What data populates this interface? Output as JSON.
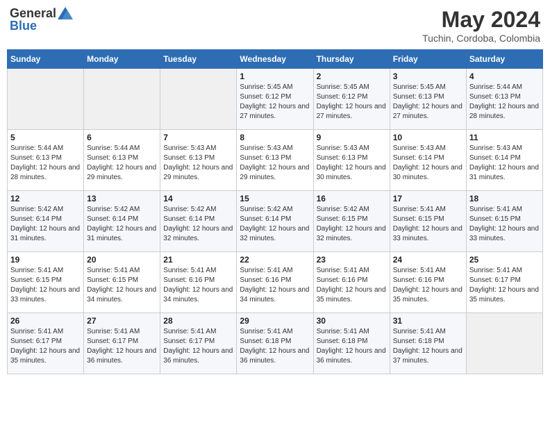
{
  "header": {
    "logo_general": "General",
    "logo_blue": "Blue",
    "title": "May 2024",
    "subtitle": "Tuchin, Cordoba, Colombia"
  },
  "days_of_week": [
    "Sunday",
    "Monday",
    "Tuesday",
    "Wednesday",
    "Thursday",
    "Friday",
    "Saturday"
  ],
  "weeks": [
    [
      {
        "day": "",
        "sunrise": "",
        "sunset": "",
        "daylight": "",
        "empty": true
      },
      {
        "day": "",
        "sunrise": "",
        "sunset": "",
        "daylight": "",
        "empty": true
      },
      {
        "day": "",
        "sunrise": "",
        "sunset": "",
        "daylight": "",
        "empty": true
      },
      {
        "day": "1",
        "sunrise": "Sunrise: 5:45 AM",
        "sunset": "Sunset: 6:12 PM",
        "daylight": "Daylight: 12 hours and 27 minutes."
      },
      {
        "day": "2",
        "sunrise": "Sunrise: 5:45 AM",
        "sunset": "Sunset: 6:12 PM",
        "daylight": "Daylight: 12 hours and 27 minutes."
      },
      {
        "day": "3",
        "sunrise": "Sunrise: 5:45 AM",
        "sunset": "Sunset: 6:13 PM",
        "daylight": "Daylight: 12 hours and 27 minutes."
      },
      {
        "day": "4",
        "sunrise": "Sunrise: 5:44 AM",
        "sunset": "Sunset: 6:13 PM",
        "daylight": "Daylight: 12 hours and 28 minutes."
      }
    ],
    [
      {
        "day": "5",
        "sunrise": "Sunrise: 5:44 AM",
        "sunset": "Sunset: 6:13 PM",
        "daylight": "Daylight: 12 hours and 28 minutes."
      },
      {
        "day": "6",
        "sunrise": "Sunrise: 5:44 AM",
        "sunset": "Sunset: 6:13 PM",
        "daylight": "Daylight: 12 hours and 29 minutes."
      },
      {
        "day": "7",
        "sunrise": "Sunrise: 5:43 AM",
        "sunset": "Sunset: 6:13 PM",
        "daylight": "Daylight: 12 hours and 29 minutes."
      },
      {
        "day": "8",
        "sunrise": "Sunrise: 5:43 AM",
        "sunset": "Sunset: 6:13 PM",
        "daylight": "Daylight: 12 hours and 29 minutes."
      },
      {
        "day": "9",
        "sunrise": "Sunrise: 5:43 AM",
        "sunset": "Sunset: 6:13 PM",
        "daylight": "Daylight: 12 hours and 30 minutes."
      },
      {
        "day": "10",
        "sunrise": "Sunrise: 5:43 AM",
        "sunset": "Sunset: 6:14 PM",
        "daylight": "Daylight: 12 hours and 30 minutes."
      },
      {
        "day": "11",
        "sunrise": "Sunrise: 5:43 AM",
        "sunset": "Sunset: 6:14 PM",
        "daylight": "Daylight: 12 hours and 31 minutes."
      }
    ],
    [
      {
        "day": "12",
        "sunrise": "Sunrise: 5:42 AM",
        "sunset": "Sunset: 6:14 PM",
        "daylight": "Daylight: 12 hours and 31 minutes."
      },
      {
        "day": "13",
        "sunrise": "Sunrise: 5:42 AM",
        "sunset": "Sunset: 6:14 PM",
        "daylight": "Daylight: 12 hours and 31 minutes."
      },
      {
        "day": "14",
        "sunrise": "Sunrise: 5:42 AM",
        "sunset": "Sunset: 6:14 PM",
        "daylight": "Daylight: 12 hours and 32 minutes."
      },
      {
        "day": "15",
        "sunrise": "Sunrise: 5:42 AM",
        "sunset": "Sunset: 6:14 PM",
        "daylight": "Daylight: 12 hours and 32 minutes."
      },
      {
        "day": "16",
        "sunrise": "Sunrise: 5:42 AM",
        "sunset": "Sunset: 6:15 PM",
        "daylight": "Daylight: 12 hours and 32 minutes."
      },
      {
        "day": "17",
        "sunrise": "Sunrise: 5:41 AM",
        "sunset": "Sunset: 6:15 PM",
        "daylight": "Daylight: 12 hours and 33 minutes."
      },
      {
        "day": "18",
        "sunrise": "Sunrise: 5:41 AM",
        "sunset": "Sunset: 6:15 PM",
        "daylight": "Daylight: 12 hours and 33 minutes."
      }
    ],
    [
      {
        "day": "19",
        "sunrise": "Sunrise: 5:41 AM",
        "sunset": "Sunset: 6:15 PM",
        "daylight": "Daylight: 12 hours and 33 minutes."
      },
      {
        "day": "20",
        "sunrise": "Sunrise: 5:41 AM",
        "sunset": "Sunset: 6:15 PM",
        "daylight": "Daylight: 12 hours and 34 minutes."
      },
      {
        "day": "21",
        "sunrise": "Sunrise: 5:41 AM",
        "sunset": "Sunset: 6:16 PM",
        "daylight": "Daylight: 12 hours and 34 minutes."
      },
      {
        "day": "22",
        "sunrise": "Sunrise: 5:41 AM",
        "sunset": "Sunset: 6:16 PM",
        "daylight": "Daylight: 12 hours and 34 minutes."
      },
      {
        "day": "23",
        "sunrise": "Sunrise: 5:41 AM",
        "sunset": "Sunset: 6:16 PM",
        "daylight": "Daylight: 12 hours and 35 minutes."
      },
      {
        "day": "24",
        "sunrise": "Sunrise: 5:41 AM",
        "sunset": "Sunset: 6:16 PM",
        "daylight": "Daylight: 12 hours and 35 minutes."
      },
      {
        "day": "25",
        "sunrise": "Sunrise: 5:41 AM",
        "sunset": "Sunset: 6:17 PM",
        "daylight": "Daylight: 12 hours and 35 minutes."
      }
    ],
    [
      {
        "day": "26",
        "sunrise": "Sunrise: 5:41 AM",
        "sunset": "Sunset: 6:17 PM",
        "daylight": "Daylight: 12 hours and 35 minutes."
      },
      {
        "day": "27",
        "sunrise": "Sunrise: 5:41 AM",
        "sunset": "Sunset: 6:17 PM",
        "daylight": "Daylight: 12 hours and 36 minutes."
      },
      {
        "day": "28",
        "sunrise": "Sunrise: 5:41 AM",
        "sunset": "Sunset: 6:17 PM",
        "daylight": "Daylight: 12 hours and 36 minutes."
      },
      {
        "day": "29",
        "sunrise": "Sunrise: 5:41 AM",
        "sunset": "Sunset: 6:18 PM",
        "daylight": "Daylight: 12 hours and 36 minutes."
      },
      {
        "day": "30",
        "sunrise": "Sunrise: 5:41 AM",
        "sunset": "Sunset: 6:18 PM",
        "daylight": "Daylight: 12 hours and 36 minutes."
      },
      {
        "day": "31",
        "sunrise": "Sunrise: 5:41 AM",
        "sunset": "Sunset: 6:18 PM",
        "daylight": "Daylight: 12 hours and 37 minutes."
      },
      {
        "day": "",
        "sunrise": "",
        "sunset": "",
        "daylight": "",
        "empty": true
      }
    ]
  ]
}
